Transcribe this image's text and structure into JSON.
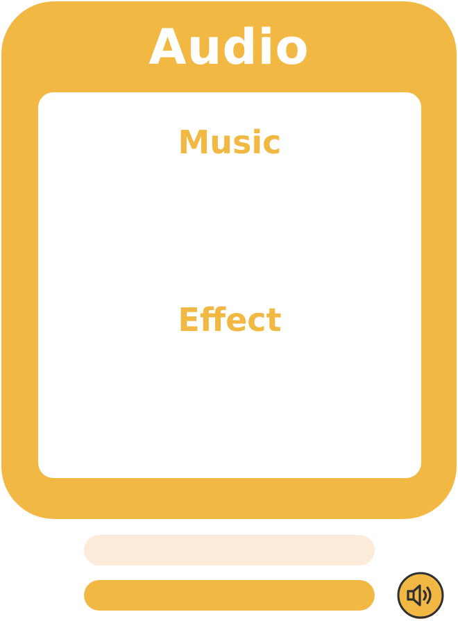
{
  "panel": {
    "title": "Audio",
    "sections": [
      {
        "label": "Music"
      },
      {
        "label": "Effect"
      }
    ]
  },
  "bars": [
    {
      "level": 0.0
    },
    {
      "level": 1.0
    }
  ],
  "sound_button": {
    "icon": "speaker-volume-icon"
  },
  "colors": {
    "accent": "#F2B844",
    "track": "#FCEBD8",
    "white": "#FFFFFF",
    "icon_stroke": "#2F2F33",
    "icon_shadow": "#E8823A"
  }
}
